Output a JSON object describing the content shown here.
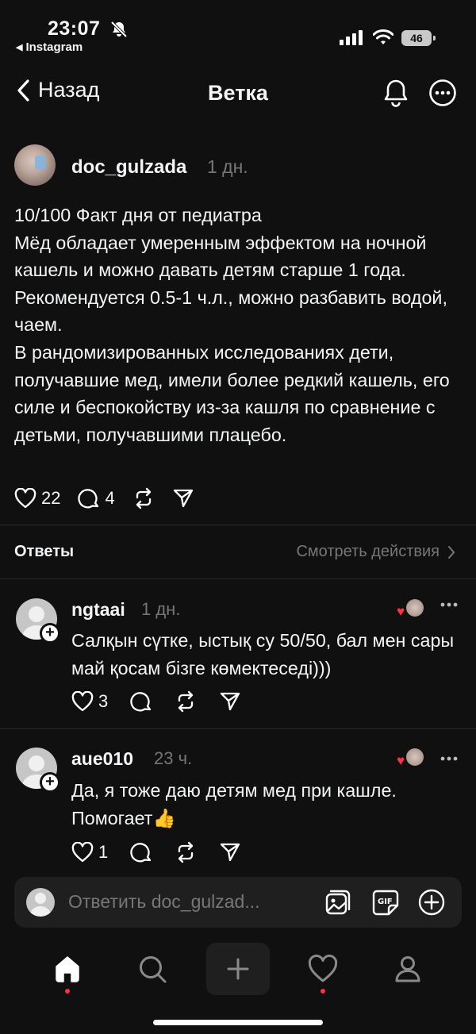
{
  "status_bar": {
    "time": "23:07",
    "back_app": "Instagram",
    "battery": "46",
    "icons": [
      "bell-slash-icon",
      "cellular-signal-icon",
      "wifi-icon",
      "battery-icon"
    ]
  },
  "header": {
    "back_label": "Назад",
    "title": "Ветка",
    "icons": [
      "chevron-left-icon",
      "bell-icon",
      "more-circle-icon"
    ]
  },
  "post": {
    "username": "doc_gulzada",
    "time": "1 дн.",
    "text": "10/100 Факт дня от педиатра\nМёд обладает умеренным эффектом на ночной кашель и можно давать детям старше 1 года. Рекомендуется 0.5-1 ч.л., можно разбавить водой, чаем.\nВ рандомизированных исследованиях дети, получавшие мед, имели более редкий кашель, его силе и беспокойству из-за кашля по сравнение с детьми, получавшими плацебо.",
    "likes": "22",
    "comments": "4"
  },
  "answers": {
    "title": "Ответы",
    "view_activity": "Смотреть действия"
  },
  "replies": [
    {
      "username": "ngtaai",
      "time": "1 дн.",
      "text": "Салқын сүтке, ыстық су 50/50, бал мен сары май қосам бізге көмектеседі)))",
      "likes": "3"
    },
    {
      "username": "aue010",
      "time": "23 ч.",
      "text": "Да, я тоже даю детям мед при кашле. Помогает👍",
      "likes": "1"
    }
  ],
  "composer": {
    "placeholder": "Ответить doc_gulzad...",
    "icons": [
      "image-icon",
      "gif-icon",
      "plus-circle-icon"
    ]
  },
  "tabbar": {
    "icons": [
      "home-icon",
      "search-icon",
      "compose-plus-icon",
      "heart-icon",
      "profile-icon"
    ]
  },
  "colors": {
    "background": "#101010",
    "text": "#f3f5f7",
    "secondary": "#777777",
    "accent_red": "#ff3040",
    "surface": "#1f1f1f"
  }
}
